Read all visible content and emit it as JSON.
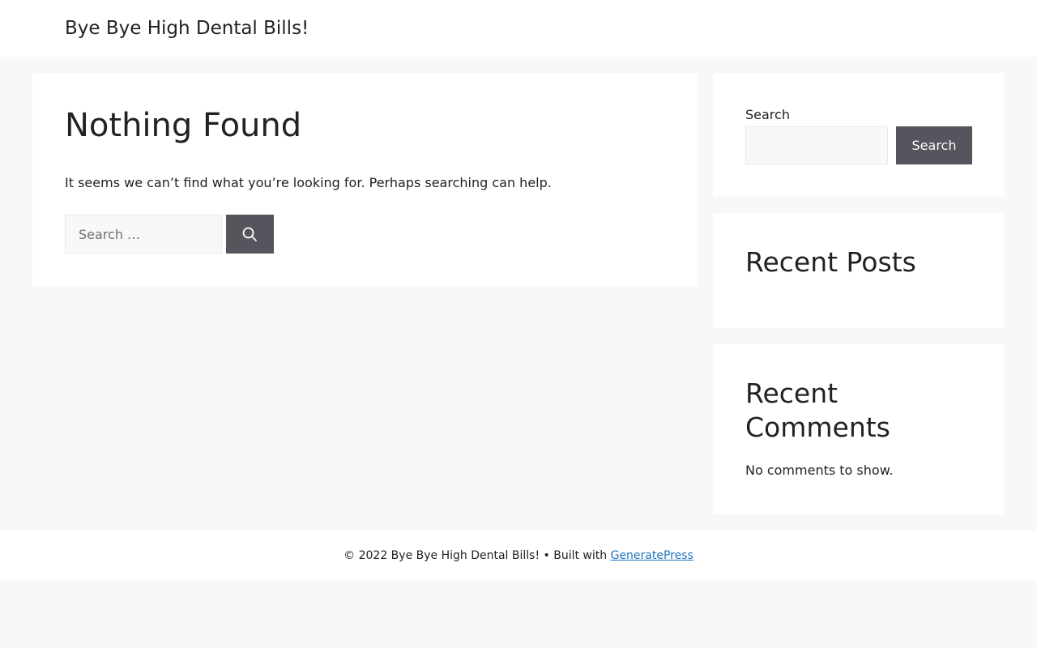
{
  "header": {
    "site_title": "Bye Bye High Dental Bills!"
  },
  "main": {
    "title": "Nothing Found",
    "message": "It seems we can’t find what you’re looking for. Perhaps searching can help.",
    "search": {
      "placeholder": "Search …",
      "value": "",
      "button_icon": "search-icon"
    }
  },
  "sidebar": {
    "search_widget": {
      "label": "Search",
      "value": "",
      "button_label": "Search"
    },
    "recent_posts": {
      "title": "Recent Posts",
      "items": []
    },
    "recent_comments": {
      "title": "Recent Comments",
      "empty_text": "No comments to show."
    }
  },
  "footer": {
    "text": "© 2022 Bye Bye High Dental Bills! • Built with ",
    "link_label": "GeneratePress"
  },
  "colors": {
    "page_background": "#f7f8f9",
    "panel_background": "#ffffff",
    "button_background": "#55555e",
    "text": "#222222",
    "link": "#1e73be"
  }
}
